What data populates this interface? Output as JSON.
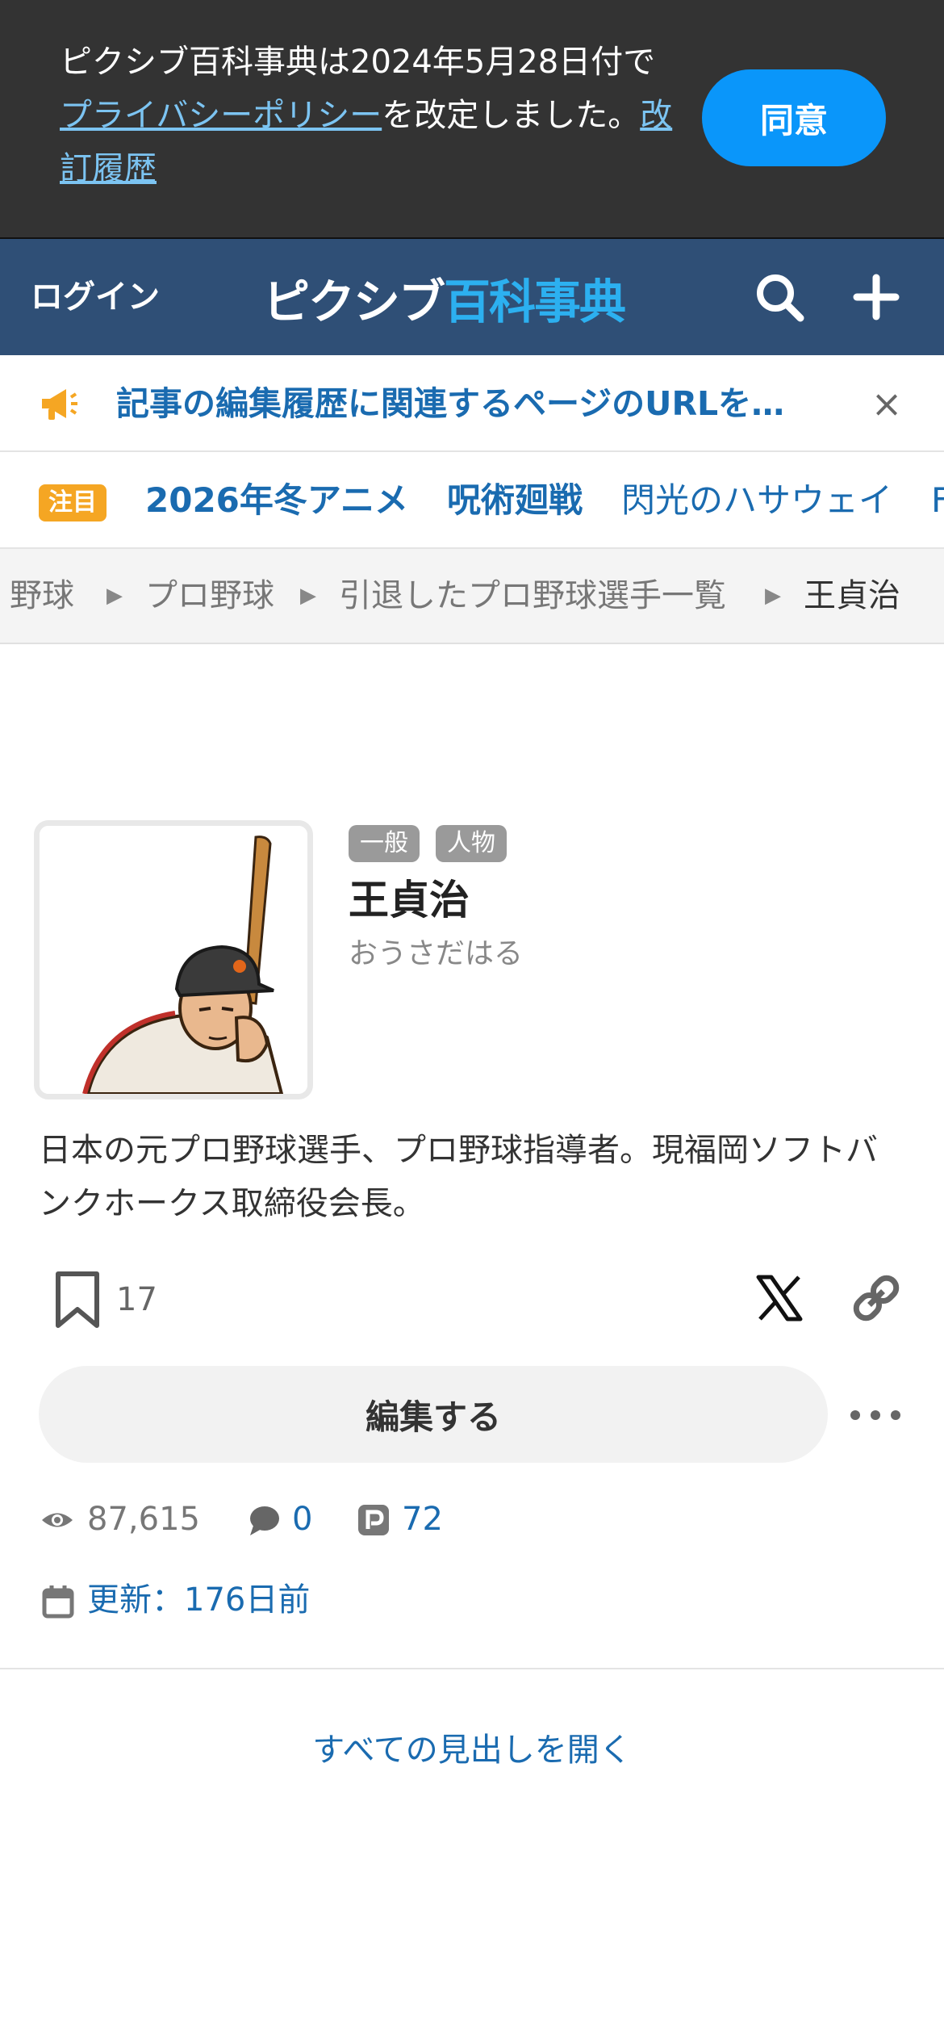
{
  "consent": {
    "text_before": "ピクシブ百科事典は2024年5月28日付で",
    "privacy_link": "プライバシーポリシー",
    "text_middle": "を改定しました。",
    "history_link": "改訂履歴",
    "agree_label": "同意"
  },
  "header": {
    "login_label": "ログイン",
    "logo_part1": "ピクシブ",
    "logo_part2": "百科事典",
    "search_icon": "search-icon",
    "plus_icon": "plus-icon"
  },
  "notice": {
    "text": "記事の編集履歴に関連するページのURLを…",
    "close_label": "×"
  },
  "trending": {
    "badge": "注目",
    "items": [
      "2026年冬アニメ",
      "呪術廻戦",
      "閃光のハサウェイ",
      "F"
    ]
  },
  "breadcrumb": {
    "items": [
      "野球",
      "プロ野球",
      "引退したプロ野球選手一覧",
      "王貞治"
    ]
  },
  "article": {
    "tags": [
      "一般",
      "人物"
    ],
    "title": "王貞治",
    "reading": "おうさだはる",
    "summary": "日本の元プロ野球選手、プロ野球指導者。現福岡ソフトバンクホークス取締役会長。",
    "bookmark_count": "17",
    "edit_label": "編集する",
    "views": "87,615",
    "comments": "0",
    "pixiv_works": "72",
    "updated": "更新：176日前",
    "open_all_label": "すべての見出しを開く"
  },
  "colors": {
    "header_bg": "#2f4f76",
    "accent_blue": "#0a96fa",
    "link_blue": "#1a6bb0",
    "badge_orange": "#f5a623"
  }
}
